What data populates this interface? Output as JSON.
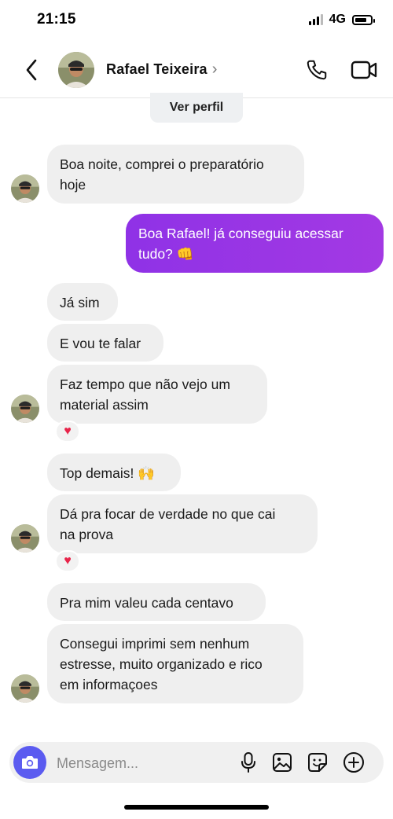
{
  "status_bar": {
    "time": "21:15",
    "network": "4G"
  },
  "header": {
    "contact_name": "Rafael Teixeira",
    "chevron": "›"
  },
  "profile_button": "Ver perfil",
  "messages": [
    {
      "text": "Boa noite, comprei o preparatório\nhoje",
      "direction": "in"
    },
    {
      "text": "Boa Rafael! já conseguiu acessar\ntudo? 👊",
      "direction": "out"
    },
    {
      "text": "Já sim",
      "direction": "in"
    },
    {
      "text": "E vou te falar",
      "direction": "in"
    },
    {
      "text": "Faz tempo que não vejo um\nmaterial assim",
      "direction": "in",
      "reaction": "♥"
    },
    {
      "text": "Top demais! 🙌",
      "direction": "in"
    },
    {
      "text": "Dá pra focar de verdade no que cai\nna prova",
      "direction": "in",
      "reaction": "♥"
    },
    {
      "text": "Pra mim valeu cada centavo",
      "direction": "in"
    },
    {
      "text": "Consegui imprimi sem nenhum\nestresse, muito organizado e rico\nem informaçoes",
      "direction": "in"
    }
  ],
  "composer": {
    "placeholder": "Mensagem...",
    "value": ""
  },
  "icons": {
    "back": "chevron-left-icon",
    "phone": "phone-icon",
    "video": "video-camera-icon",
    "camera": "camera-icon",
    "mic": "microphone-icon",
    "gallery": "image-icon",
    "sticker": "sticker-icon",
    "add": "plus-circle-icon"
  },
  "colors": {
    "outgoing_bubble": "#9b36e4",
    "incoming_bubble": "#efefef",
    "camera_button": "#5b5bf0",
    "reaction_heart": "#e8244a"
  }
}
